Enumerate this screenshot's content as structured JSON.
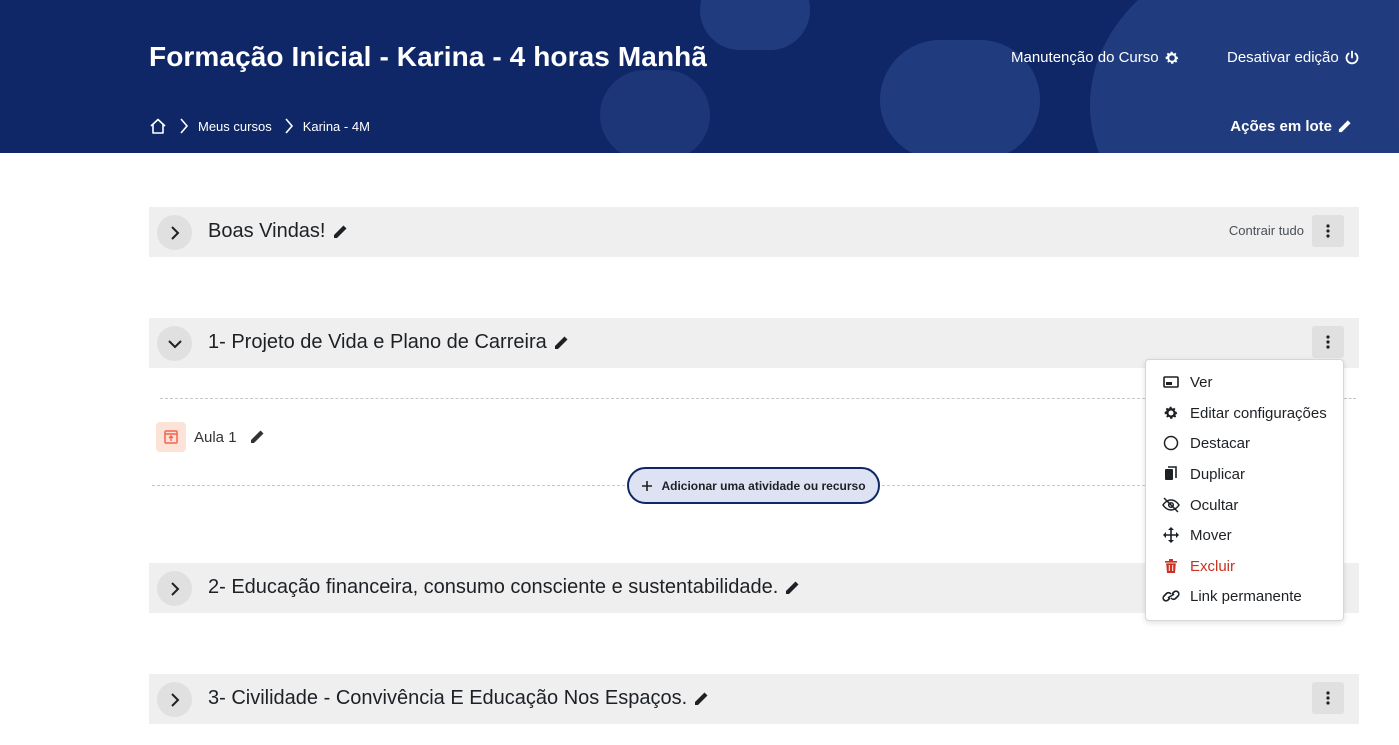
{
  "header": {
    "course_title": "Formação Inicial - Karina - 4 horas Manhã",
    "maintenance_label": "Manutenção do Curso",
    "edit_mode_label": "Desativar edição",
    "bulk_actions_label": "Ações em lote",
    "breadcrumb": [
      "Meus cursos",
      "Karina - 4M"
    ]
  },
  "sections": [
    {
      "title": "Boas Vindas!",
      "expanded": false,
      "collapse_all_label": "Contrair tudo"
    },
    {
      "title": "1- Projeto de Vida e Plano de Carreira",
      "expanded": true
    },
    {
      "title": "2- Educação financeira, consumo consciente e sustentabilidade.",
      "expanded": false
    },
    {
      "title": "3- Civilidade - Convivência E Educação Nos Espaços.",
      "expanded": false
    }
  ],
  "activity": {
    "name": "Aula 1",
    "icon": "page-icon"
  },
  "add_activity_label": "Adicionar uma atividade ou recurso",
  "section_menu": {
    "items": [
      {
        "label": "Ver",
        "icon": "view-icon"
      },
      {
        "label": "Editar configurações",
        "icon": "gear-icon"
      },
      {
        "label": "Destacar",
        "icon": "circle-icon"
      },
      {
        "label": "Duplicar",
        "icon": "copy-icon"
      },
      {
        "label": "Ocultar",
        "icon": "eye-slash-icon"
      },
      {
        "label": "Mover",
        "icon": "move-icon"
      },
      {
        "label": "Excluir",
        "icon": "trash-icon",
        "color": "#ca3120"
      },
      {
        "label": "Link permanente",
        "icon": "link-icon"
      }
    ]
  },
  "colors": {
    "brand": "#0f2767",
    "section_bg": "#efefef",
    "danger": "#ca3120",
    "activity_icon_bg": "#fbe3d7",
    "activity_icon": "#f7634d"
  }
}
